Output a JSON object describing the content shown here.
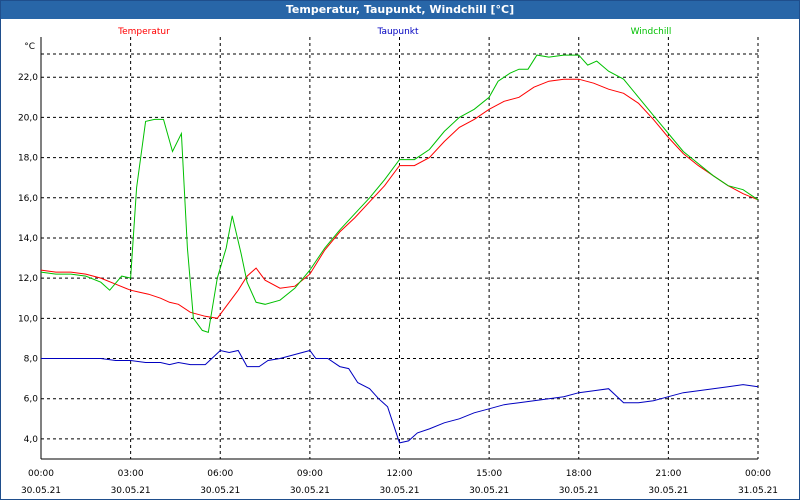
{
  "window": {
    "title": "Temperatur, Taupunkt, Windchill [°C]"
  },
  "chart_data": {
    "type": "line",
    "title": "Temperatur, Taupunkt, Windchill [°C]",
    "ylabel": "°C",
    "ylim": [
      3.0,
      24.0
    ],
    "xlim_hours": [
      0,
      24
    ],
    "grid": true,
    "legend_placement": "top",
    "y_ticks": [
      "4,0",
      "6,0",
      "8,0",
      "10,0",
      "12,0",
      "14,0",
      "16,0",
      "18,0",
      "20,0",
      "22,0"
    ],
    "x_ticks": [
      {
        "time": "00:00",
        "date": "30.05.21"
      },
      {
        "time": "03:00",
        "date": "30.05.21"
      },
      {
        "time": "06:00",
        "date": "30.05.21"
      },
      {
        "time": "09:00",
        "date": "30.05.21"
      },
      {
        "time": "12:00",
        "date": "30.05.21"
      },
      {
        "time": "15:00",
        "date": "30.05.21"
      },
      {
        "time": "18:00",
        "date": "30.05.21"
      },
      {
        "time": "21:00",
        "date": "30.05.21"
      },
      {
        "time": "00:00",
        "date": "31.05.21"
      }
    ],
    "series": [
      {
        "name": "Temperatur",
        "color": "#ff0000",
        "points": [
          [
            0,
            12.4
          ],
          [
            0.5,
            12.3
          ],
          [
            1,
            12.3
          ],
          [
            1.5,
            12.2
          ],
          [
            2,
            12.0
          ],
          [
            2.5,
            11.7
          ],
          [
            3,
            11.4
          ],
          [
            3.3,
            11.3
          ],
          [
            3.6,
            11.2
          ],
          [
            4,
            11.0
          ],
          [
            4.3,
            10.8
          ],
          [
            4.6,
            10.7
          ],
          [
            5,
            10.3
          ],
          [
            5.5,
            10.1
          ],
          [
            5.9,
            10.0
          ],
          [
            6.2,
            10.6
          ],
          [
            6.6,
            11.4
          ],
          [
            6.9,
            12.1
          ],
          [
            7.2,
            12.5
          ],
          [
            7.5,
            11.9
          ],
          [
            8,
            11.5
          ],
          [
            8.5,
            11.6
          ],
          [
            9,
            12.2
          ],
          [
            9.5,
            13.4
          ],
          [
            10,
            14.3
          ],
          [
            10.5,
            15.0
          ],
          [
            11,
            15.8
          ],
          [
            11.5,
            16.6
          ],
          [
            12,
            17.6
          ],
          [
            12.5,
            17.6
          ],
          [
            13,
            18.0
          ],
          [
            13.5,
            18.8
          ],
          [
            14,
            19.5
          ],
          [
            14.5,
            19.9
          ],
          [
            15,
            20.4
          ],
          [
            15.5,
            20.8
          ],
          [
            16,
            21.0
          ],
          [
            16.5,
            21.5
          ],
          [
            17,
            21.8
          ],
          [
            17.5,
            21.9
          ],
          [
            18,
            21.9
          ],
          [
            18.5,
            21.7
          ],
          [
            19,
            21.4
          ],
          [
            19.5,
            21.2
          ],
          [
            20,
            20.7
          ],
          [
            20.5,
            19.9
          ],
          [
            21,
            19.0
          ],
          [
            21.5,
            18.2
          ],
          [
            22,
            17.6
          ],
          [
            22.5,
            17.1
          ],
          [
            23,
            16.6
          ],
          [
            23.5,
            16.2
          ],
          [
            24,
            15.9
          ]
        ]
      },
      {
        "name": "Taupunkt",
        "color": "#0000c0",
        "points": [
          [
            0,
            8.0
          ],
          [
            0.5,
            8.0
          ],
          [
            1,
            8.0
          ],
          [
            1.5,
            8.0
          ],
          [
            2,
            8.0
          ],
          [
            2.5,
            7.9
          ],
          [
            3,
            7.9
          ],
          [
            3.5,
            7.8
          ],
          [
            4,
            7.8
          ],
          [
            4.3,
            7.7
          ],
          [
            4.6,
            7.8
          ],
          [
            5,
            7.7
          ],
          [
            5.5,
            7.7
          ],
          [
            6,
            8.4
          ],
          [
            6.3,
            8.3
          ],
          [
            6.6,
            8.4
          ],
          [
            6.9,
            7.6
          ],
          [
            7.3,
            7.6
          ],
          [
            7.6,
            7.9
          ],
          [
            8,
            8.0
          ],
          [
            8.5,
            8.2
          ],
          [
            9,
            8.4
          ],
          [
            9.2,
            8.0
          ],
          [
            9.6,
            8.0
          ],
          [
            10,
            7.6
          ],
          [
            10.3,
            7.5
          ],
          [
            10.6,
            6.8
          ],
          [
            11,
            6.5
          ],
          [
            11.3,
            6.0
          ],
          [
            11.6,
            5.6
          ],
          [
            12,
            3.8
          ],
          [
            12.3,
            3.9
          ],
          [
            12.6,
            4.3
          ],
          [
            13,
            4.5
          ],
          [
            13.5,
            4.8
          ],
          [
            14,
            5.0
          ],
          [
            14.5,
            5.3
          ],
          [
            15,
            5.5
          ],
          [
            15.5,
            5.7
          ],
          [
            16,
            5.8
          ],
          [
            16.5,
            5.9
          ],
          [
            17,
            6.0
          ],
          [
            17.5,
            6.1
          ],
          [
            18,
            6.3
          ],
          [
            18.5,
            6.4
          ],
          [
            19,
            6.5
          ],
          [
            19.5,
            5.8
          ],
          [
            20,
            5.8
          ],
          [
            20.5,
            5.9
          ],
          [
            21,
            6.1
          ],
          [
            21.5,
            6.3
          ],
          [
            22,
            6.4
          ],
          [
            22.5,
            6.5
          ],
          [
            23,
            6.6
          ],
          [
            23.5,
            6.7
          ],
          [
            24,
            6.6
          ]
        ]
      },
      {
        "name": "Windchill",
        "color": "#00c000",
        "points": [
          [
            0,
            12.3
          ],
          [
            0.5,
            12.2
          ],
          [
            1,
            12.2
          ],
          [
            1.5,
            12.1
          ],
          [
            2,
            11.8
          ],
          [
            2.3,
            11.4
          ],
          [
            2.7,
            12.1
          ],
          [
            3,
            12.0
          ],
          [
            3.2,
            16.5
          ],
          [
            3.5,
            19.8
          ],
          [
            3.8,
            19.9
          ],
          [
            4.1,
            19.9
          ],
          [
            4.4,
            18.3
          ],
          [
            4.7,
            19.2
          ],
          [
            4.9,
            13.5
          ],
          [
            5.1,
            10.0
          ],
          [
            5.4,
            9.4
          ],
          [
            5.6,
            9.3
          ],
          [
            5.9,
            12.0
          ],
          [
            6.2,
            13.5
          ],
          [
            6.4,
            15.1
          ],
          [
            6.7,
            13.2
          ],
          [
            6.9,
            11.8
          ],
          [
            7.2,
            10.8
          ],
          [
            7.5,
            10.7
          ],
          [
            8,
            10.9
          ],
          [
            8.5,
            11.5
          ],
          [
            9,
            12.4
          ],
          [
            9.5,
            13.5
          ],
          [
            10,
            14.4
          ],
          [
            10.5,
            15.2
          ],
          [
            11,
            16.0
          ],
          [
            11.5,
            16.9
          ],
          [
            12,
            17.9
          ],
          [
            12.5,
            17.9
          ],
          [
            13,
            18.4
          ],
          [
            13.5,
            19.3
          ],
          [
            14,
            20.0
          ],
          [
            14.5,
            20.4
          ],
          [
            15,
            21.0
          ],
          [
            15.3,
            21.8
          ],
          [
            15.7,
            22.2
          ],
          [
            16,
            22.4
          ],
          [
            16.3,
            22.4
          ],
          [
            16.6,
            23.1
          ],
          [
            17,
            23.0
          ],
          [
            17.5,
            23.1
          ],
          [
            18,
            23.1
          ],
          [
            18.3,
            22.6
          ],
          [
            18.6,
            22.8
          ],
          [
            19,
            22.3
          ],
          [
            19.5,
            21.9
          ],
          [
            20,
            21.0
          ],
          [
            20.5,
            20.1
          ],
          [
            21,
            19.2
          ],
          [
            21.5,
            18.3
          ],
          [
            22,
            17.7
          ],
          [
            22.5,
            17.1
          ],
          [
            23,
            16.6
          ],
          [
            23.5,
            16.4
          ],
          [
            24,
            15.9
          ]
        ]
      }
    ]
  }
}
